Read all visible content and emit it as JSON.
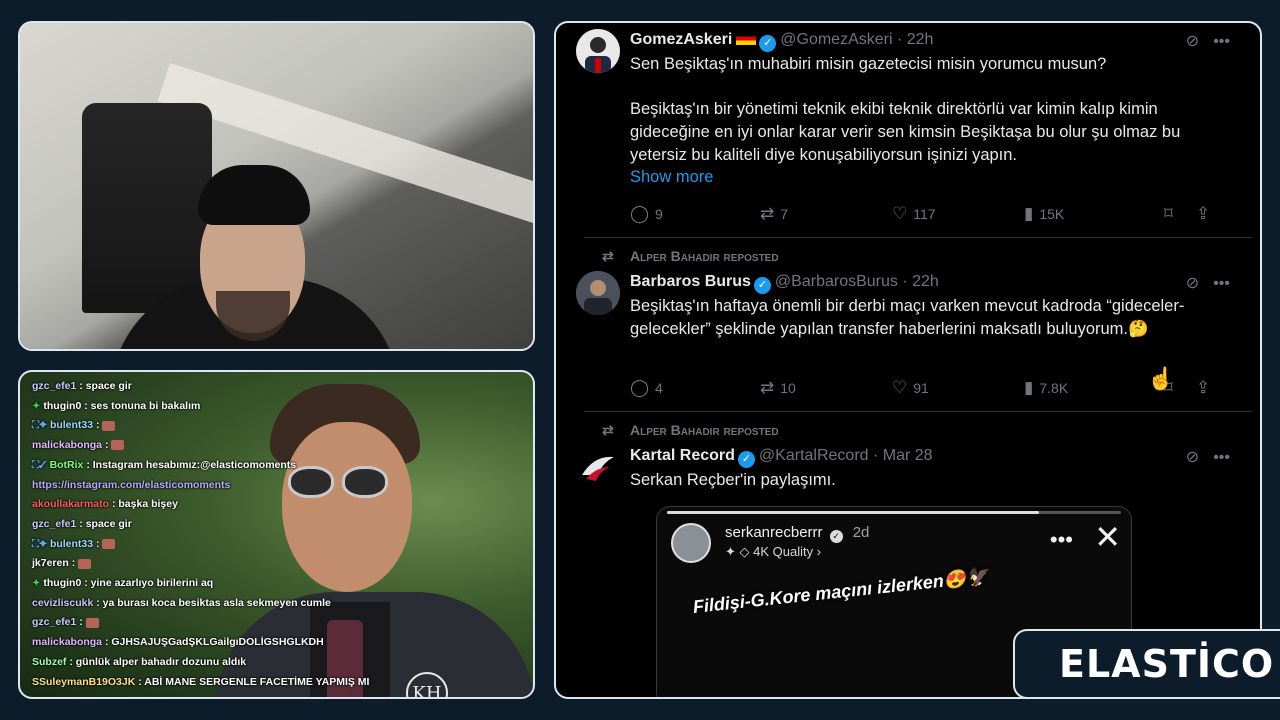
{
  "chat": {
    "lines": [
      {
        "badges": "",
        "user": "gzc_efe1",
        "user_color": "#c9c9ff",
        "msg": ": space gir",
        "emote": false
      },
      {
        "badges": "✦",
        "user": "thugin0",
        "user_color": "#ffffff",
        "msg": ": ses tonuna bi bakalım",
        "emote": false
      },
      {
        "badges": "⛶✦",
        "user": "bulent33",
        "user_color": "#9fd7ff",
        "msg": ":",
        "emote": true
      },
      {
        "badges": "",
        "user": "malickabonga",
        "user_color": "#e1b8ff",
        "msg": ":",
        "emote": true
      },
      {
        "badges": "⛶✓",
        "user": "BotRix",
        "user_color": "#7cff7c",
        "msg": ": Instagram hesabımız:@elasticomoments",
        "emote": false
      },
      {
        "badges": "",
        "user": "https://instagram.com/elasticomoments",
        "user_color": "#b9a8ff",
        "msg": "",
        "emote": false
      },
      {
        "badges": "",
        "user": "akoullakarmato",
        "user_color": "#ff5b5b",
        "msg": ": başka bişey",
        "emote": false
      },
      {
        "badges": "",
        "user": "gzc_efe1",
        "user_color": "#c9c9ff",
        "msg": ": space gir",
        "emote": false
      },
      {
        "badges": "⛶✦",
        "user": "bulent33",
        "user_color": "#9fd7ff",
        "msg": ":",
        "emote": true
      },
      {
        "badges": "",
        "user": "jk7eren",
        "user_color": "#ffffff",
        "msg": ":",
        "emote": true
      },
      {
        "badges": "✦",
        "user": "thugin0",
        "user_color": "#ffffff",
        "msg": ": yine azarlıyo birilerini aq",
        "emote": false
      },
      {
        "badges": "",
        "user": "cevizliscukk",
        "user_color": "#cfc2ff",
        "msg": ": ya burası koca besiktas asla sekmeyen cumle",
        "emote": false
      },
      {
        "badges": "",
        "user": "gzc_efe1",
        "user_color": "#c9c9ff",
        "msg": ":",
        "emote": true
      },
      {
        "badges": "",
        "user": "malickabonga",
        "user_color": "#e1b8ff",
        "msg": ": GJHSAJUŞGadŞKLGailgıDOLİGSHGLKDH",
        "emote": false
      },
      {
        "badges": "",
        "user": "Subzef",
        "user_color": "#9dffb0",
        "msg": ": günlük alper bahadır dozunu aldık",
        "emote": false
      },
      {
        "badges": "",
        "user": "SSuleymanB19O3JK",
        "user_color": "#ffe08a",
        "msg": ": ABİ MANE SERGENLE FACETİME YAPMIŞ MI",
        "emote": false
      }
    ]
  },
  "twitter": {
    "tweets": [
      {
        "repost": "",
        "name": "GomezAskeri",
        "flag": true,
        "handle": "@GomezAskeri · 22h",
        "text": "Sen Beşiktaş'ın muhabiri misin gazetecisi misin yorumcu musun?\n\nBeşiktaş'ın bir yönetimi teknik ekibi teknik direktörlü var kimin kalıp kimin gideceğine en iyi onlar karar verir sen kimsin Beşiktaşa bu olur şu olmaz bu yetersiz bu kaliteli diye konuşabiliyorsun işinizi yapın.",
        "show_more": "Show more",
        "replies": "9",
        "reposts": "7",
        "likes": "117",
        "views": "15K"
      },
      {
        "repost": "Alper Bahadır reposted",
        "name": "Barbaros Burus",
        "flag": false,
        "handle": "@BarbarosBurus · 22h",
        "text": "Beşiktaş'ın haftaya önemli bir derbi maçı varken mevcut kadroda “gideceler-gelecekler” şeklinde yapılan transfer haberlerini maksatlı buluyorum.🤔",
        "show_more": "",
        "replies": "4",
        "reposts": "10",
        "likes": "91",
        "views": "7.8K"
      },
      {
        "repost": "Alper Bahadır reposted",
        "name": "Kartal Record",
        "flag": false,
        "handle": "@KartalRecord · Mar 28",
        "text": "Serkan Reçber'in paylaşımı.",
        "show_more": "",
        "replies": "",
        "reposts": "",
        "likes": "",
        "views": ""
      }
    ],
    "story": {
      "username": "serkanrecberrr",
      "time": "2d",
      "quality": "✦ ◇ 4K Quality ›",
      "caption": "Fildişi-G.Kore maçını izlerken😍🦅",
      "progress": 0.82
    }
  },
  "brand": {
    "logo_text": "ELASTİCO"
  },
  "colors": {
    "background": "#0d1c2b",
    "accent": "#1d9bf0",
    "panel_border": "#dfe6ee"
  }
}
